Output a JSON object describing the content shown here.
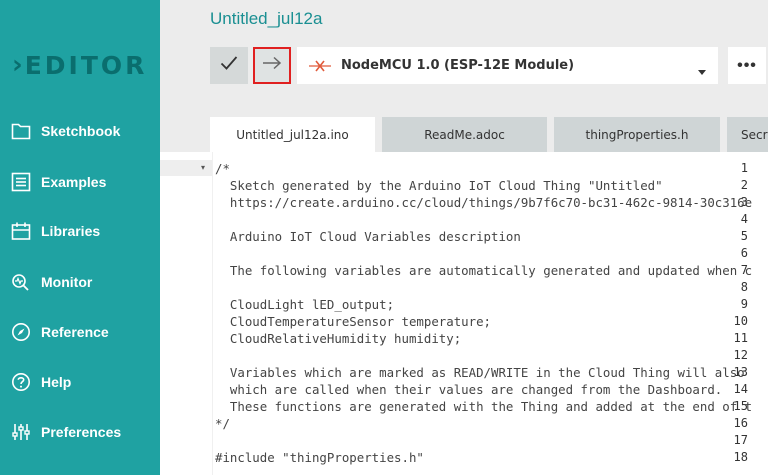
{
  "brand": {
    "logo_text": "EDITOR",
    "logo_chevron": "›"
  },
  "sidebar": {
    "items": [
      {
        "label": "Sketchbook",
        "icon": "folder-icon"
      },
      {
        "label": "Examples",
        "icon": "list-icon"
      },
      {
        "label": "Libraries",
        "icon": "library-icon"
      },
      {
        "label": "Monitor",
        "icon": "monitor-icon"
      },
      {
        "label": "Reference",
        "icon": "compass-icon"
      },
      {
        "label": "Help",
        "icon": "help-icon"
      },
      {
        "label": "Preferences",
        "icon": "sliders-icon"
      }
    ]
  },
  "header": {
    "sketch_title": "Untitled_jul12a"
  },
  "toolbar": {
    "verify_icon": "check-icon",
    "upload_icon": "arrow-right-icon",
    "board_name": "NodeMCU 1.0 (ESP-12E Module)",
    "more_label": "•••"
  },
  "tabs": [
    {
      "label": "Untitled_jul12a.ino",
      "active": true
    },
    {
      "label": "ReadMe.adoc",
      "active": false
    },
    {
      "label": "thingProperties.h",
      "active": false
    },
    {
      "label": "Secr",
      "active": false
    }
  ],
  "code": {
    "lines": [
      {
        "n": "1",
        "text": "/*"
      },
      {
        "n": "2",
        "text": "  Sketch generated by the Arduino IoT Cloud Thing \"Untitled\""
      },
      {
        "n": "3",
        "text": "  https://create.arduino.cc/cloud/things/9b7f6c70-bc31-462c-9814-30c316e"
      },
      {
        "n": "4",
        "text": ""
      },
      {
        "n": "5",
        "text": "  Arduino IoT Cloud Variables description"
      },
      {
        "n": "6",
        "text": ""
      },
      {
        "n": "7",
        "text": "  The following variables are automatically generated and updated when c"
      },
      {
        "n": "8",
        "text": ""
      },
      {
        "n": "9",
        "text": "  CloudLight lED_output;"
      },
      {
        "n": "10",
        "text": "  CloudTemperatureSensor temperature;"
      },
      {
        "n": "11",
        "text": "  CloudRelativeHumidity humidity;"
      },
      {
        "n": "12",
        "text": ""
      },
      {
        "n": "13",
        "text": "  Variables which are marked as READ/WRITE in the Cloud Thing will also"
      },
      {
        "n": "14",
        "text": "  which are called when their values are changed from the Dashboard."
      },
      {
        "n": "15",
        "text": "  These functions are generated with the Thing and added at the end of t"
      },
      {
        "n": "16",
        "text": "*/"
      },
      {
        "n": "17",
        "text": ""
      },
      {
        "n": "18",
        "text": "#include \"thingProperties.h\""
      }
    ]
  },
  "colors": {
    "sidebar_bg": "#1fa2a2",
    "logo": "#0a6e6e",
    "title": "#1a8f92",
    "highlight_border": "#e02020",
    "board_x": "#e05a3a"
  }
}
